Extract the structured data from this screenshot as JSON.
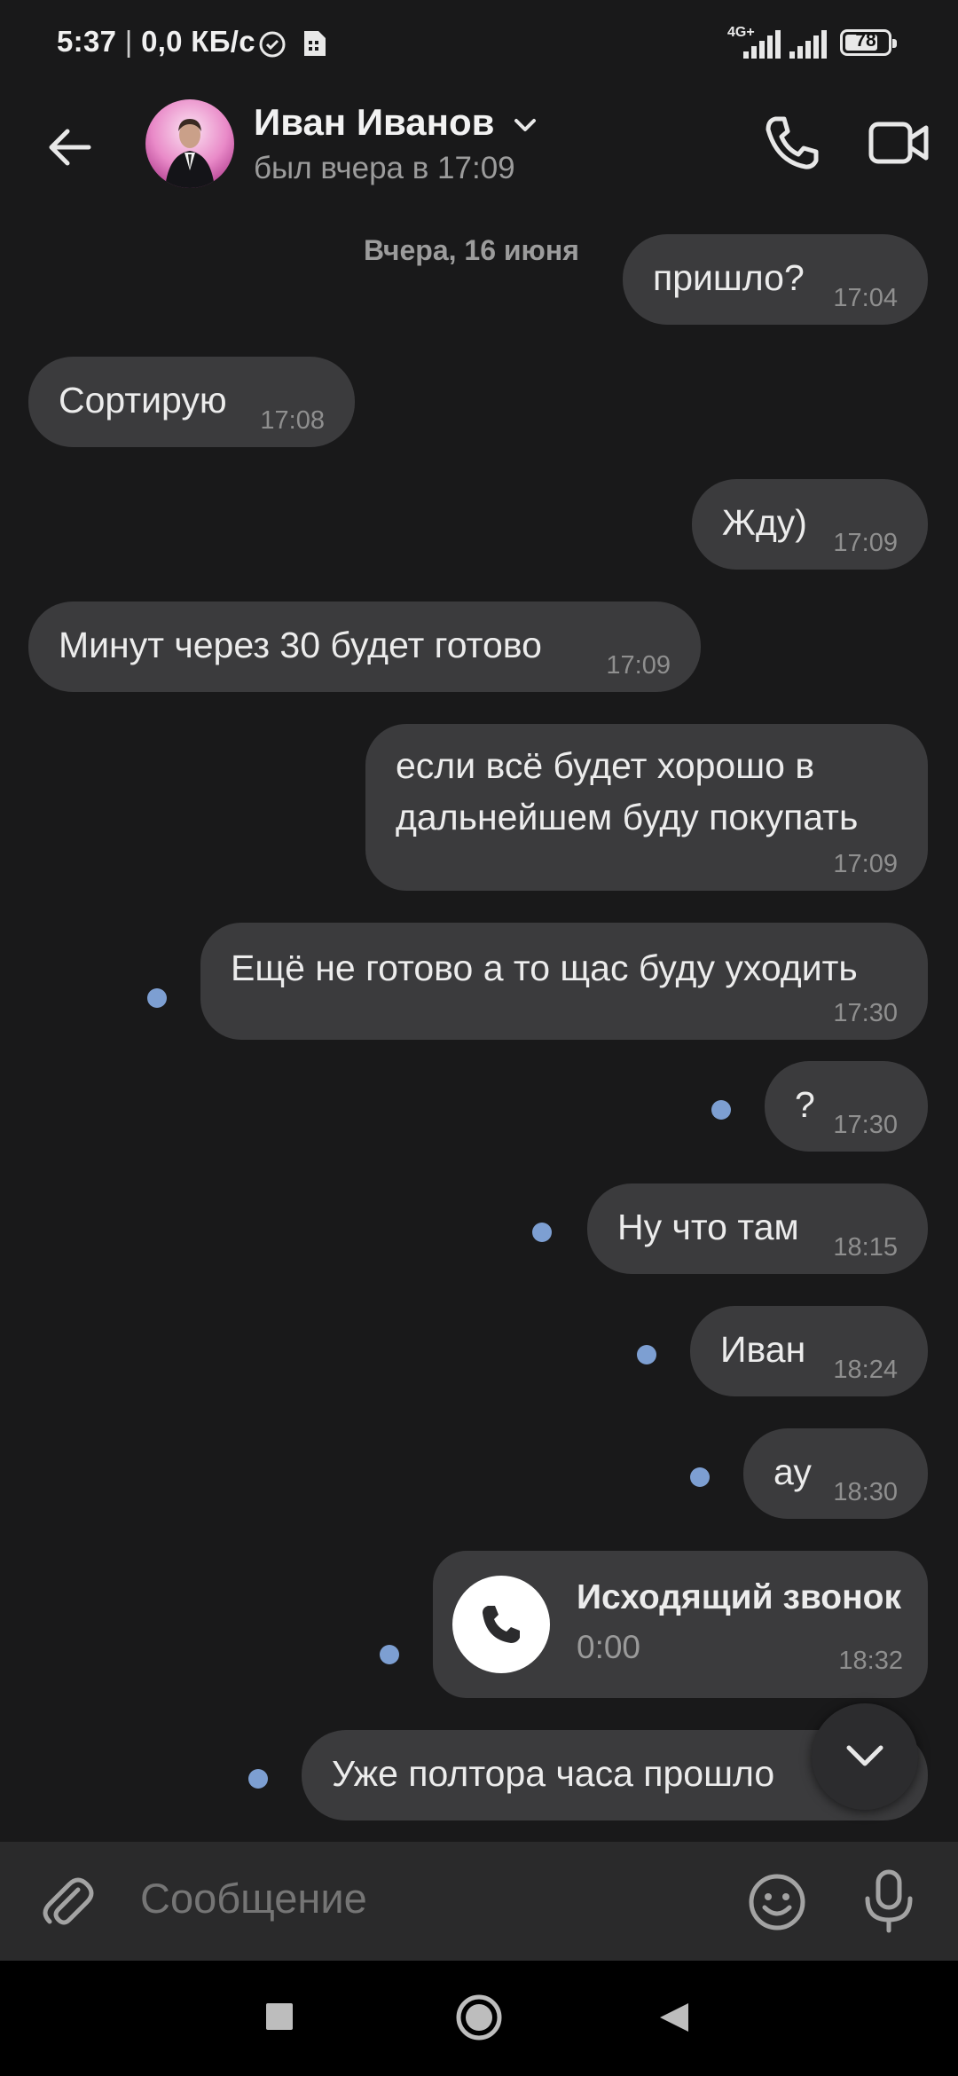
{
  "status_bar": {
    "time": "5:37",
    "speed": "0,0 КБ/с",
    "network": "4G+",
    "battery": "78",
    "battery_percent": 78
  },
  "header": {
    "contact_name": "Иван Иванов",
    "last_seen": "был вчера в 17:09"
  },
  "chat": {
    "date_label": "Вчера, 16 июня",
    "messages": [
      {
        "direction": "out",
        "text": "пришло?",
        "time": "17:04"
      },
      {
        "direction": "in",
        "text": "Сортирую",
        "time": "17:08"
      },
      {
        "direction": "out",
        "text": "Жду)",
        "time": "17:09"
      },
      {
        "direction": "in",
        "text": "Минут через 30 будет готово",
        "time": "17:09"
      },
      {
        "direction": "out",
        "lines": [
          "если всё будет хорошо в",
          "дальнейшем буду покупать"
        ],
        "time": "17:09"
      },
      {
        "direction": "out",
        "text": "Ещё не готово а то щас буду уходить",
        "time": "17:30",
        "unread": true
      },
      {
        "direction": "out",
        "text": "?",
        "time": "17:30",
        "unread": true
      },
      {
        "direction": "out",
        "text": "Ну что там",
        "time": "18:15",
        "unread": true
      },
      {
        "direction": "out",
        "text": "Иван",
        "time": "18:24",
        "unread": true
      },
      {
        "direction": "out",
        "text": "ау",
        "time": "18:30",
        "unread": true
      },
      {
        "direction": "out",
        "type": "call",
        "title": "Исходящий звонок",
        "duration": "0:00",
        "time": "18:32",
        "unread": true
      },
      {
        "direction": "out",
        "text": "Уже полтора часа прошло",
        "time": "",
        "unread": true
      }
    ]
  },
  "composer": {
    "placeholder": "Сообщение"
  },
  "colors": {
    "background": "#19191a",
    "bubble": "#3b3b3d",
    "unread_dot": "#7d9fd2",
    "composer": "#2a2a2b"
  },
  "icons": [
    "sim-icon",
    "alarm-icon",
    "signal-icon",
    "battery-icon",
    "back-arrow-icon",
    "chevron-down-icon",
    "phone-icon",
    "video-camera-icon",
    "attach-icon",
    "emoji-icon",
    "microphone-icon",
    "square-nav-icon",
    "circle-nav-icon",
    "triangle-back-icon"
  ]
}
